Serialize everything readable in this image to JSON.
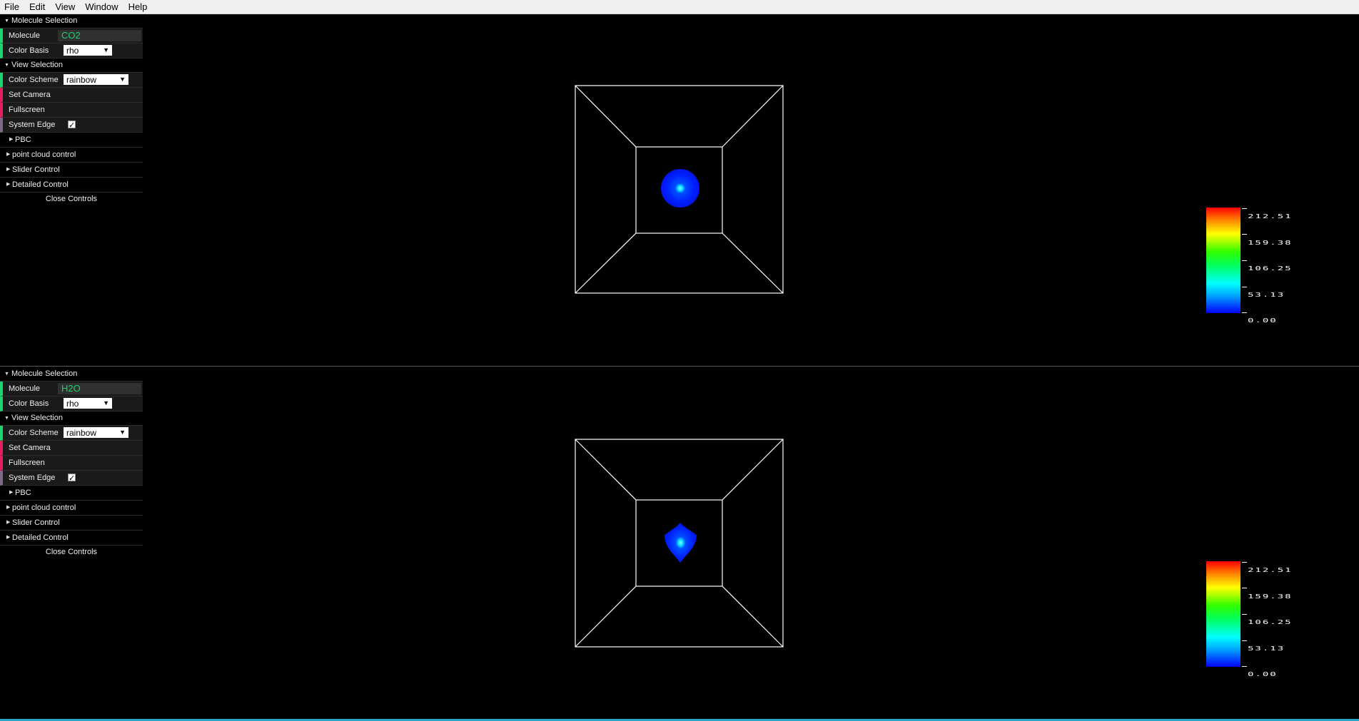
{
  "menu": [
    "File",
    "Edit",
    "View",
    "Window",
    "Help"
  ],
  "panels": [
    {
      "molecule_selection_title": "Molecule Selection",
      "molecule_label": "Molecule",
      "molecule_value": "CO2",
      "color_basis_label": "Color Basis",
      "color_basis_value": "rho",
      "view_selection_title": "View Selection",
      "color_scheme_label": "Color Scheme",
      "color_scheme_value": "rainbow",
      "set_camera_label": "Set Camera",
      "fullscreen_label": "Fullscreen",
      "system_edge_label": "System Edge",
      "system_edge_checked": true,
      "pbc_label": "PBC",
      "point_cloud_label": "point cloud control",
      "slider_control_label": "Slider Control",
      "detailed_control_label": "Detailed Control",
      "close_controls_label": "Close Controls",
      "colorbar_labels": [
        "212.51",
        "159.38",
        "106.25",
        "53.13",
        "0.00"
      ],
      "particle_shape": "sphere"
    },
    {
      "molecule_selection_title": "Molecule Selection",
      "molecule_label": "Molecule",
      "molecule_value": "H2O",
      "color_basis_label": "Color Basis",
      "color_basis_value": "rho",
      "view_selection_title": "View Selection",
      "color_scheme_label": "Color Scheme",
      "color_scheme_value": "rainbow",
      "set_camera_label": "Set Camera",
      "fullscreen_label": "Fullscreen",
      "system_edge_label": "System Edge",
      "system_edge_checked": true,
      "pbc_label": "PBC",
      "point_cloud_label": "point cloud control",
      "slider_control_label": "Slider Control",
      "detailed_control_label": "Detailed Control",
      "close_controls_label": "Close Controls",
      "colorbar_labels": [
        "212.51",
        "159.38",
        "106.25",
        "53.13",
        "0.00"
      ],
      "particle_shape": "diamond"
    }
  ],
  "colors": {
    "control_green": "#1ed36f",
    "control_red": "#e61d5f",
    "control_grey": "#806787",
    "particle_outer": "#0019ff",
    "particle_core": "#00d8ff"
  },
  "icons": [
    "folder-open-arrow-icon",
    "folder-closed-arrow-icon",
    "dropdown-caret-icon",
    "checkbox-checked-icon"
  ]
}
